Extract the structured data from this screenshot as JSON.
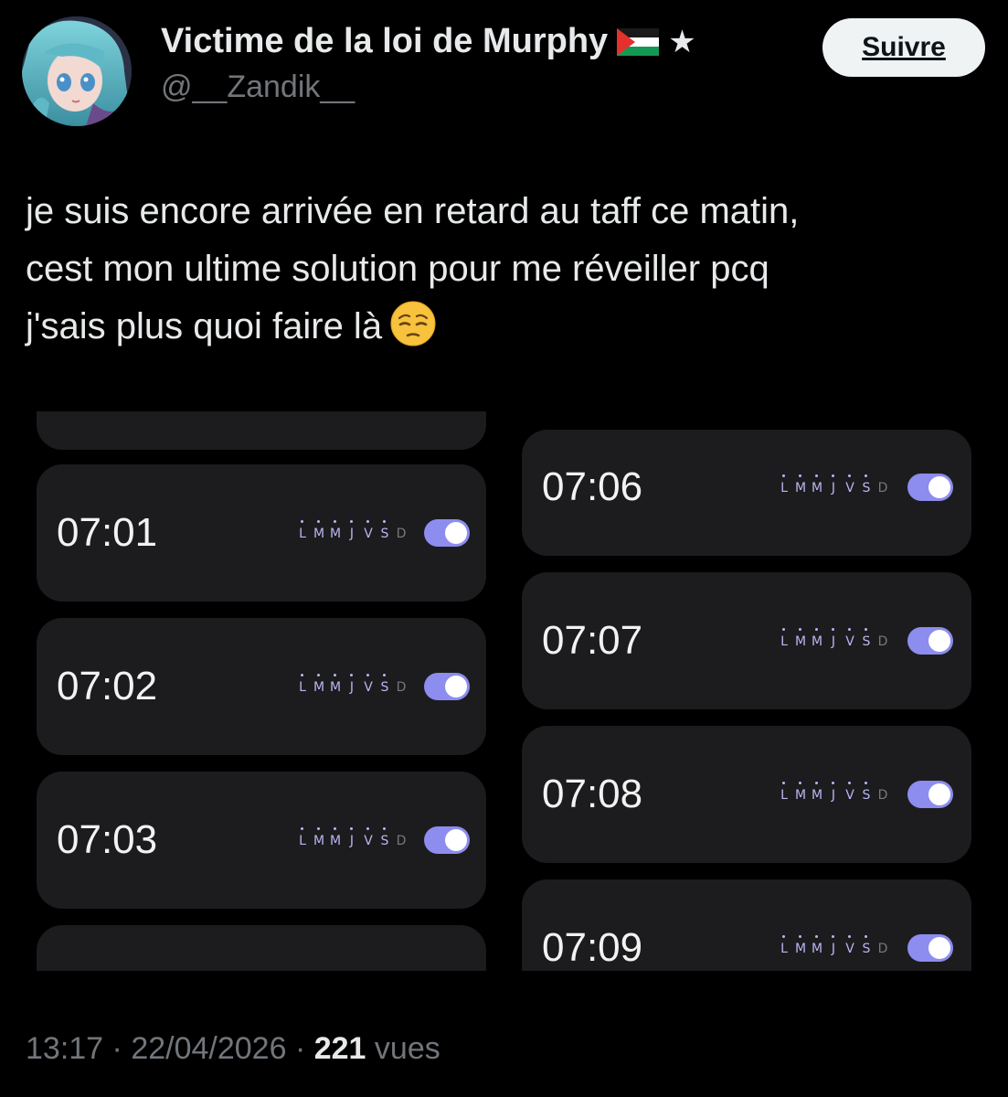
{
  "header": {
    "display_name": "Victime de la loi de Murphy",
    "handle": "@__Zandik__",
    "follow_label": "Suivre",
    "flag_icon": "palestine-flag-icon",
    "star_icon": "star-icon"
  },
  "tweet": {
    "lines": [
      "je suis encore arrivée en retard au taff ce matin,",
      "cest mon ultime solution pour me réveiller pcq",
      "j'sais plus quoi faire là"
    ],
    "emoji": "pleading-face-emoji-icon"
  },
  "media": {
    "days": [
      "L",
      "M",
      "M",
      "J",
      "V",
      "S",
      "D"
    ],
    "days_enabled": [
      true,
      true,
      true,
      true,
      true,
      true,
      false
    ],
    "accent_color": "#8d8cef",
    "left_column": [
      {
        "time": "07:01",
        "enabled": true
      },
      {
        "time": "07:02",
        "enabled": true
      },
      {
        "time": "07:03",
        "enabled": true
      }
    ],
    "right_column": [
      {
        "time": "07:06",
        "enabled": true
      },
      {
        "time": "07:07",
        "enabled": true
      },
      {
        "time": "07:08",
        "enabled": true
      },
      {
        "time": "07:09",
        "enabled": true
      }
    ]
  },
  "footer": {
    "time": "13:17",
    "separator": "·",
    "date": "22/04/2026",
    "views_count": "221",
    "views_label": "vues"
  }
}
